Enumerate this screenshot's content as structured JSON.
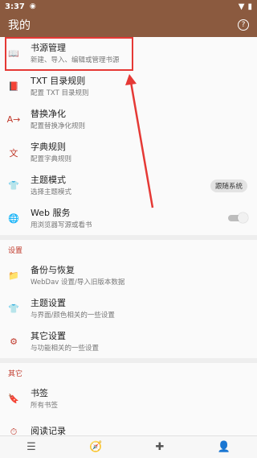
{
  "status": {
    "time": "3:37",
    "dot": "◉",
    "wifi": "▼",
    "battery": "▮"
  },
  "appbar": {
    "title": "我的",
    "help": "?"
  },
  "items": [
    {
      "icon": "📖",
      "title": "书源管理",
      "sub": "新建、导入、编辑或管理书源"
    },
    {
      "icon": "📕",
      "title": "TXT 目录规则",
      "sub": "配置 TXT 目录规则"
    },
    {
      "icon": "A→",
      "title": "替换净化",
      "sub": "配置替换净化规则"
    },
    {
      "icon": "文",
      "title": "字典规则",
      "sub": "配置字典规则"
    },
    {
      "icon": "👕",
      "title": "主题模式",
      "sub": "选择主题模式",
      "pill": "跟随系统"
    },
    {
      "icon": "🌐",
      "title": "Web 服务",
      "sub": "用浏览器写源或看书"
    }
  ],
  "section_settings": "设置",
  "settings": [
    {
      "icon": "📁",
      "title": "备份与恢复",
      "sub": "WebDav 设置/导入旧版本数据"
    },
    {
      "icon": "👕",
      "title": "主题设置",
      "sub": "与界面/颜色相关的一些设置"
    },
    {
      "icon": "⚙",
      "title": "其它设置",
      "sub": "与功能相关的一些设置"
    }
  ],
  "section_other": "其它",
  "other": [
    {
      "icon": "🔖",
      "title": "书签",
      "sub": "所有书签"
    },
    {
      "icon": "⏱",
      "title": "阅读记录",
      "sub": ""
    }
  ],
  "nav": [
    {
      "icon": "☰"
    },
    {
      "icon": "🧭"
    },
    {
      "icon": "✚"
    },
    {
      "icon": "👤"
    }
  ],
  "colors": {
    "bar": "#8b5a3f",
    "accent": "#c0392b"
  }
}
